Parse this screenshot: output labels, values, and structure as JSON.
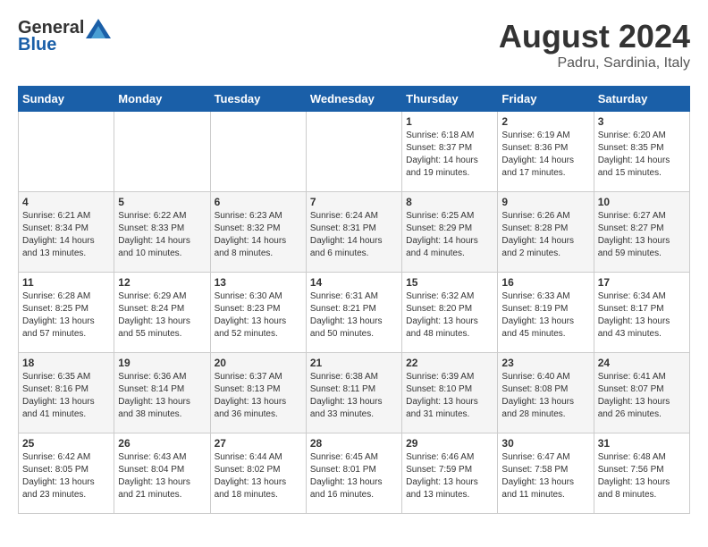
{
  "header": {
    "logo_general": "General",
    "logo_blue": "Blue",
    "month": "August 2024",
    "location": "Padru, Sardinia, Italy"
  },
  "days_of_week": [
    "Sunday",
    "Monday",
    "Tuesday",
    "Wednesday",
    "Thursday",
    "Friday",
    "Saturday"
  ],
  "weeks": [
    [
      {
        "day": "",
        "info": ""
      },
      {
        "day": "",
        "info": ""
      },
      {
        "day": "",
        "info": ""
      },
      {
        "day": "",
        "info": ""
      },
      {
        "day": "1",
        "info": "Sunrise: 6:18 AM\nSunset: 8:37 PM\nDaylight: 14 hours\nand 19 minutes."
      },
      {
        "day": "2",
        "info": "Sunrise: 6:19 AM\nSunset: 8:36 PM\nDaylight: 14 hours\nand 17 minutes."
      },
      {
        "day": "3",
        "info": "Sunrise: 6:20 AM\nSunset: 8:35 PM\nDaylight: 14 hours\nand 15 minutes."
      }
    ],
    [
      {
        "day": "4",
        "info": "Sunrise: 6:21 AM\nSunset: 8:34 PM\nDaylight: 14 hours\nand 13 minutes."
      },
      {
        "day": "5",
        "info": "Sunrise: 6:22 AM\nSunset: 8:33 PM\nDaylight: 14 hours\nand 10 minutes."
      },
      {
        "day": "6",
        "info": "Sunrise: 6:23 AM\nSunset: 8:32 PM\nDaylight: 14 hours\nand 8 minutes."
      },
      {
        "day": "7",
        "info": "Sunrise: 6:24 AM\nSunset: 8:31 PM\nDaylight: 14 hours\nand 6 minutes."
      },
      {
        "day": "8",
        "info": "Sunrise: 6:25 AM\nSunset: 8:29 PM\nDaylight: 14 hours\nand 4 minutes."
      },
      {
        "day": "9",
        "info": "Sunrise: 6:26 AM\nSunset: 8:28 PM\nDaylight: 14 hours\nand 2 minutes."
      },
      {
        "day": "10",
        "info": "Sunrise: 6:27 AM\nSunset: 8:27 PM\nDaylight: 13 hours\nand 59 minutes."
      }
    ],
    [
      {
        "day": "11",
        "info": "Sunrise: 6:28 AM\nSunset: 8:25 PM\nDaylight: 13 hours\nand 57 minutes."
      },
      {
        "day": "12",
        "info": "Sunrise: 6:29 AM\nSunset: 8:24 PM\nDaylight: 13 hours\nand 55 minutes."
      },
      {
        "day": "13",
        "info": "Sunrise: 6:30 AM\nSunset: 8:23 PM\nDaylight: 13 hours\nand 52 minutes."
      },
      {
        "day": "14",
        "info": "Sunrise: 6:31 AM\nSunset: 8:21 PM\nDaylight: 13 hours\nand 50 minutes."
      },
      {
        "day": "15",
        "info": "Sunrise: 6:32 AM\nSunset: 8:20 PM\nDaylight: 13 hours\nand 48 minutes."
      },
      {
        "day": "16",
        "info": "Sunrise: 6:33 AM\nSunset: 8:19 PM\nDaylight: 13 hours\nand 45 minutes."
      },
      {
        "day": "17",
        "info": "Sunrise: 6:34 AM\nSunset: 8:17 PM\nDaylight: 13 hours\nand 43 minutes."
      }
    ],
    [
      {
        "day": "18",
        "info": "Sunrise: 6:35 AM\nSunset: 8:16 PM\nDaylight: 13 hours\nand 41 minutes."
      },
      {
        "day": "19",
        "info": "Sunrise: 6:36 AM\nSunset: 8:14 PM\nDaylight: 13 hours\nand 38 minutes."
      },
      {
        "day": "20",
        "info": "Sunrise: 6:37 AM\nSunset: 8:13 PM\nDaylight: 13 hours\nand 36 minutes."
      },
      {
        "day": "21",
        "info": "Sunrise: 6:38 AM\nSunset: 8:11 PM\nDaylight: 13 hours\nand 33 minutes."
      },
      {
        "day": "22",
        "info": "Sunrise: 6:39 AM\nSunset: 8:10 PM\nDaylight: 13 hours\nand 31 minutes."
      },
      {
        "day": "23",
        "info": "Sunrise: 6:40 AM\nSunset: 8:08 PM\nDaylight: 13 hours\nand 28 minutes."
      },
      {
        "day": "24",
        "info": "Sunrise: 6:41 AM\nSunset: 8:07 PM\nDaylight: 13 hours\nand 26 minutes."
      }
    ],
    [
      {
        "day": "25",
        "info": "Sunrise: 6:42 AM\nSunset: 8:05 PM\nDaylight: 13 hours\nand 23 minutes."
      },
      {
        "day": "26",
        "info": "Sunrise: 6:43 AM\nSunset: 8:04 PM\nDaylight: 13 hours\nand 21 minutes."
      },
      {
        "day": "27",
        "info": "Sunrise: 6:44 AM\nSunset: 8:02 PM\nDaylight: 13 hours\nand 18 minutes."
      },
      {
        "day": "28",
        "info": "Sunrise: 6:45 AM\nSunset: 8:01 PM\nDaylight: 13 hours\nand 16 minutes."
      },
      {
        "day": "29",
        "info": "Sunrise: 6:46 AM\nSunset: 7:59 PM\nDaylight: 13 hours\nand 13 minutes."
      },
      {
        "day": "30",
        "info": "Sunrise: 6:47 AM\nSunset: 7:58 PM\nDaylight: 13 hours\nand 11 minutes."
      },
      {
        "day": "31",
        "info": "Sunrise: 6:48 AM\nSunset: 7:56 PM\nDaylight: 13 hours\nand 8 minutes."
      }
    ]
  ]
}
